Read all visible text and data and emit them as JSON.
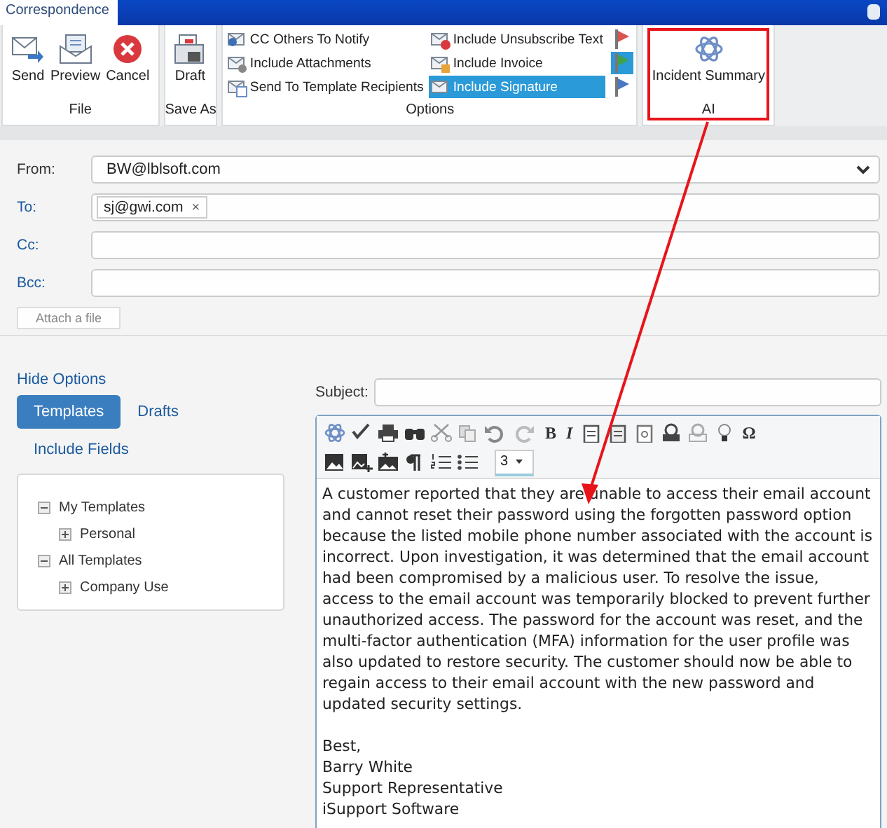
{
  "window": {
    "title": "Correspondence"
  },
  "ribbon": {
    "groups": [
      {
        "kind": "buttons",
        "label": "File",
        "buttons": [
          {
            "label": "Send"
          },
          {
            "label": "Preview"
          },
          {
            "label": "Cancel"
          }
        ]
      },
      {
        "kind": "buttons",
        "label": "Save As",
        "buttons": [
          {
            "label": "Draft"
          }
        ]
      },
      {
        "kind": "options",
        "label": "Options",
        "columns": [
          [
            {
              "label": "CC Others To Notify",
              "selected": false
            },
            {
              "label": "Include Attachments",
              "selected": false
            },
            {
              "label": "Send To Template Recipients",
              "selected": false
            }
          ],
          [
            {
              "label": "Include Unsubscribe Text",
              "selected": false
            },
            {
              "label": "Include Invoice",
              "selected": false
            },
            {
              "label": "Include Signature",
              "selected": true
            }
          ]
        ],
        "flags": [
          {
            "color": "#d9534f",
            "selected": false
          },
          {
            "color": "#3fa34d",
            "selected": true
          },
          {
            "color": "#4a78c2",
            "selected": false
          }
        ]
      },
      {
        "kind": "buttons",
        "label": "AI",
        "buttons": [
          {
            "label": "Incident Summary"
          }
        ]
      }
    ]
  },
  "form": {
    "from": {
      "label": "From:",
      "value": "BW@lblsoft.com"
    },
    "to": {
      "label": "To:",
      "chips": [
        "sj@gwi.com"
      ],
      "remove": "×"
    },
    "cc": {
      "label": "Cc:"
    },
    "bcc": {
      "label": "Bcc:"
    },
    "attach": "Attach a file"
  },
  "options_panel": {
    "toggle": "Hide Options",
    "tabs": [
      {
        "label": "Templates",
        "selected": true
      },
      {
        "label": "Drafts",
        "selected": false
      }
    ],
    "include_fields": "Include Fields",
    "tree": [
      {
        "label": "My Templates",
        "expanded": true,
        "children": [
          {
            "label": "Personal",
            "expanded": false
          }
        ]
      },
      {
        "label": "All Templates",
        "expanded": true,
        "children": [
          {
            "label": "Company Use",
            "expanded": false
          }
        ]
      }
    ]
  },
  "subject": {
    "label": "Subject:"
  },
  "editor": {
    "toolbar": {
      "bold": "B",
      "italic": "I",
      "special": "Ω",
      "font_size": "3"
    },
    "paragraphs": [
      "A customer reported that they are unable to access their email account and cannot reset their password using the forgotten password option because the listed mobile phone number associated with the account is incorrect. Upon investigation, it was determined that the email account had been compromised by a malicious user. To resolve the issue, access to the email account was temporarily blocked to prevent further unauthorized access. The password for the account was reset, and the multi-factor authentication (MFA) information for the user profile was also updated to restore security. The customer should now be able to regain access to their email account with the new password and updated security settings."
    ],
    "signature": [
      "Best,",
      "Barry White",
      "Support Representative",
      "iSupport Software"
    ]
  }
}
